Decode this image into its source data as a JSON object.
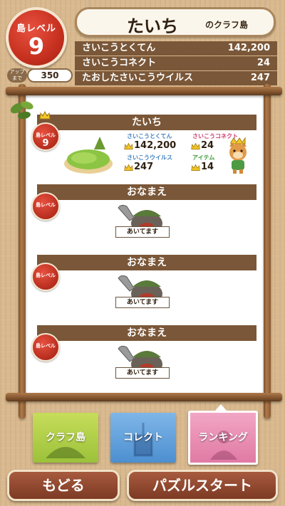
{
  "header": {
    "island_level_label": "島レベル",
    "island_level_value": "9",
    "up_label_line1": "アップ",
    "up_label_line2": "まで",
    "up_value": "350",
    "player_name": "たいち",
    "island_suffix": "のクラフ島"
  },
  "stats": [
    {
      "label": "さいこうとくてん",
      "value": "142,200"
    },
    {
      "label": "さいこうコネクト",
      "value": "24"
    },
    {
      "label": "たおしたさいこうウイルス",
      "value": "247"
    }
  ],
  "rows": [
    {
      "name": "たいち",
      "level_label": "島レベル",
      "level": "9",
      "score_label": "さいこうとくてん",
      "score": "142,200",
      "connect_label": "さいこうコネクト",
      "connect": "24",
      "virus_label": "さいこうウイルス",
      "virus": "247",
      "item_label": "アイテム",
      "item": "14"
    },
    {
      "name": "おなまえ",
      "level_label": "島レベル",
      "vacant_label": "あいてます"
    },
    {
      "name": "おなまえ",
      "level_label": "島レベル",
      "vacant_label": "あいてます"
    },
    {
      "name": "おなまえ",
      "level_label": "島レベル",
      "vacant_label": "あいてます"
    }
  ],
  "menu": {
    "island": "クラフ島",
    "collect": "コレクト",
    "ranking": "ランキング",
    "selected": "ランキング"
  },
  "buttons": {
    "back": "もどる",
    "start": "パズルスタート"
  },
  "colors": {
    "level_red": "#c6301f",
    "bar_brown": "#7a5738",
    "island_green": "#9cc13a",
    "collect_blue": "#4c8fd0",
    "ranking_pink": "#e07aa4",
    "button_brown": "#7d3a24"
  },
  "icons": [
    "crown-icon",
    "leaf-icon",
    "island-icon",
    "cat-avatar-icon",
    "mole-shovel-icon"
  ]
}
